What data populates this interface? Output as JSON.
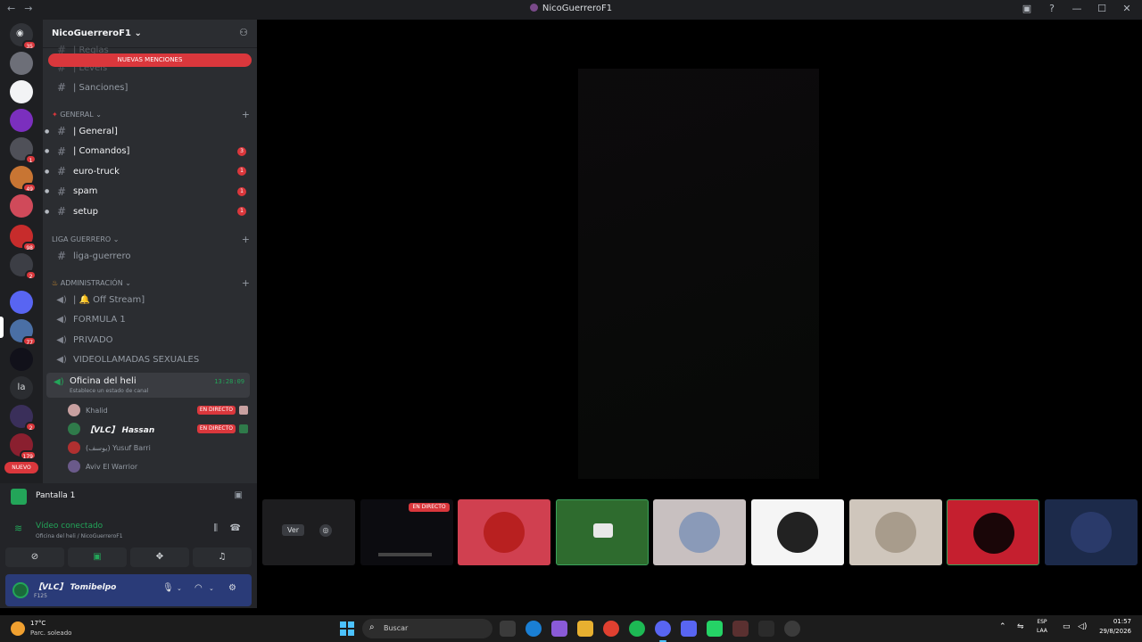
{
  "window": {
    "title": "NicoGuerreroF1",
    "nav_back": "←",
    "nav_forward": "→",
    "inbox_icon": "inbox-icon",
    "help_icon": "help-icon",
    "minimize": "—",
    "maximize": "☐",
    "close": "✕"
  },
  "server_rail": {
    "home_badge": "35",
    "servers": [
      {
        "name": "server-1",
        "color": "#6d6f78",
        "badge": ""
      },
      {
        "name": "server-2",
        "color": "#f2f3f5",
        "badge": ""
      },
      {
        "name": "server-3",
        "color": "#7b2fbe",
        "badge": ""
      },
      {
        "name": "server-4",
        "color": "#4f5058",
        "badge": "1"
      },
      {
        "name": "server-5",
        "color": "#c87533",
        "badge": "49"
      },
      {
        "name": "server-6",
        "color": "#d04a5a",
        "badge": ""
      },
      {
        "name": "server-7",
        "color": "#c72c2c",
        "badge": "98"
      },
      {
        "name": "server-8",
        "color": "#3c3e45",
        "badge": "2"
      },
      {
        "name": "server-9",
        "color": "#5865f2",
        "badge": ""
      },
      {
        "name": "server-10",
        "color": "#4a6fa5",
        "badge": "77"
      },
      {
        "name": "server-11",
        "color": "#11111a",
        "badge": ""
      },
      {
        "name": "server-12",
        "color": "#2b2d31",
        "badge": "",
        "text": "la"
      },
      {
        "name": "server-13",
        "color": "#3a2f5a",
        "badge": "2"
      },
      {
        "name": "server-14",
        "color": "#8a1f2f",
        "badge": "179"
      }
    ],
    "new_label": "NUEVO"
  },
  "sidebar": {
    "server_name": "NicoGuerreroF1",
    "server_chevron": "⌄",
    "new_mentions": "NUEVAS MENCIONES",
    "faded_channels": [
      "| Reglas",
      "| Levels"
    ],
    "top_channel": "| Sanciones]",
    "categories": {
      "general": "GENERAL",
      "liga": "LIGA GUERRERO",
      "admin": "ADMINISTRACIÓN"
    },
    "general_channels": [
      {
        "name": "| General]",
        "count": ""
      },
      {
        "name": "| Comandos]",
        "count": "3"
      },
      {
        "name": "euro-truck",
        "count": "1"
      },
      {
        "name": "spam",
        "count": "1"
      },
      {
        "name": "setup",
        "count": "1"
      }
    ],
    "liga_channels": [
      {
        "name": "liga-guerrero"
      }
    ],
    "voice_channels": [
      {
        "name": "| 🔔 Off Stream]"
      },
      {
        "name": "FORMULA 1"
      },
      {
        "name": "PRIVADO"
      },
      {
        "name": "VIDEOLLAMADAS SEXUALES"
      }
    ],
    "active_voice": {
      "name": "Oficina del heli",
      "status": "Establece un estado de canal",
      "timer": "13:28:09"
    },
    "voice_users": [
      {
        "name": "Khalid",
        "live": "EN DIRECTO",
        "color": "#c8a0a0",
        "bold": false
      },
      {
        "name": "【VLC】 Hassan",
        "live": "EN DIRECTO",
        "color": "#2f7a4a",
        "bold": true
      },
      {
        "name": "(يوسف) Yusuf Barri",
        "live": "",
        "color": "#b03030",
        "bold": false
      },
      {
        "name": "Aviv El Warrior",
        "live": "",
        "color": "#6a5a8a",
        "bold": false
      }
    ]
  },
  "panel": {
    "share_label": "Pantalla 1",
    "connected": "Vídeo conectado",
    "connected_sub": "Oficina del heli / NicoGuerreroF1",
    "user_name": "【VLC】 Tomibelpo",
    "user_tag": "F125"
  },
  "stage": {
    "tiles": [
      {
        "kind": "ver",
        "label": "Ver",
        "bg": "#1d1d1f"
      },
      {
        "kind": "stream",
        "live": "EN DIRECTO",
        "bg": "#0c0c10"
      },
      {
        "kind": "avatar",
        "bg": "#d04050",
        "avatar": "#b82020"
      },
      {
        "kind": "cam",
        "bg": "#2e6b2e"
      },
      {
        "kind": "avatar",
        "bg": "#c8c0c0",
        "avatar": "#8a9ab8"
      },
      {
        "kind": "avatar",
        "bg": "#f5f5f5",
        "avatar": "#222222"
      },
      {
        "kind": "avatar",
        "bg": "#cfc6bc",
        "avatar": "#a89c8c"
      },
      {
        "kind": "avatar",
        "bg": "#c51f2f",
        "avatar": "#1a0608"
      },
      {
        "kind": "avatar",
        "bg": "#1c2a4a",
        "avatar": "#2a3a6a"
      }
    ]
  },
  "taskbar": {
    "temp": "17°C",
    "condition": "Parc. soleado",
    "search_placeholder": "Buscar",
    "lang_top": "ESP",
    "lang_bottom": "LAA",
    "time": "01:57",
    "date": "29/8/2026"
  }
}
